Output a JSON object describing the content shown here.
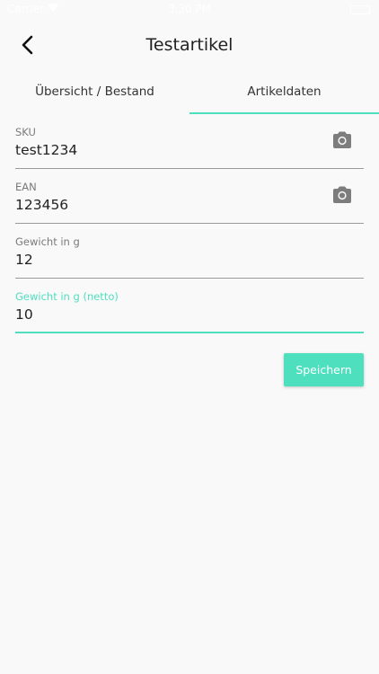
{
  "status_bar": {
    "carrier": "Carrier",
    "time": "3:30 PM"
  },
  "nav": {
    "title": "Testartikel",
    "back_icon": "chevron-left-icon"
  },
  "tabs": [
    {
      "label": "Übersicht / Bestand",
      "active": false
    },
    {
      "label": "Artikeldaten",
      "active": true
    }
  ],
  "form": {
    "fields": [
      {
        "label": "SKU",
        "value": "test1234",
        "has_camera": true
      },
      {
        "label": "EAN",
        "value": "123456",
        "has_camera": true
      },
      {
        "label": "Gewicht in g",
        "value": "12",
        "has_camera": false
      },
      {
        "label": "Gewicht in g (netto)",
        "value": "10",
        "has_camera": false,
        "focused": true
      }
    ]
  },
  "save_button": {
    "label": "Speichern"
  },
  "colors": {
    "accent": "#4ee0be",
    "background": "#f9f9f9",
    "text": "#222222",
    "label": "#7a7a7a"
  }
}
